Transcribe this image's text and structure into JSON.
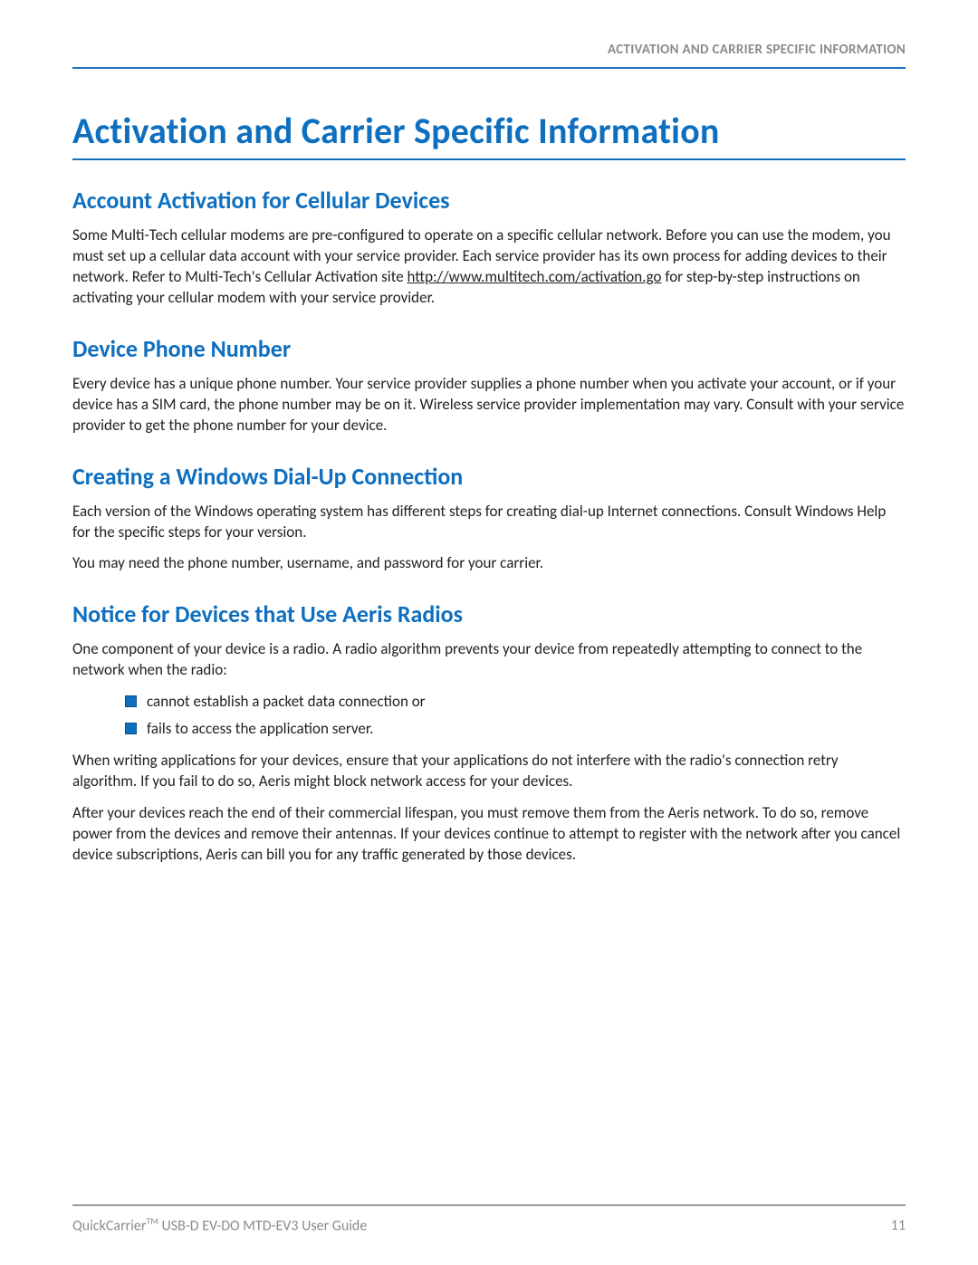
{
  "header": {
    "running_title": "ACTIVATION AND CARRIER SPECIFIC INFORMATION"
  },
  "h1": "Activation and Carrier Specific Information",
  "sections": {
    "acct": {
      "title": "Account Activation for Cellular Devices",
      "p1a": "Some Multi-Tech cellular modems are pre-configured to operate on a specific cellular network. Before you can use the modem, you must set up a cellular data account with your service provider. Each service provider has its own process for adding devices to their network. Refer to Multi-Tech's Cellular Activation site ",
      "link_text": "http://www.multitech.com/activation.go",
      "p1b": " for step-by-step instructions on activating your cellular modem with your service provider."
    },
    "phone": {
      "title": "Device Phone Number",
      "p1": "Every device has a unique phone number. Your service provider supplies a phone number when you activate your account, or if your device has a SIM card, the phone number may be on it. Wireless service provider implementation may vary. Consult with your service provider to get the phone number for your device."
    },
    "dialup": {
      "title": "Creating a Windows Dial-Up Connection",
      "p1": "Each version of the Windows operating system has different steps for creating dial-up Internet connections. Consult Windows Help for the specific steps for your version.",
      "p2": "You may need the phone number, username, and password for your carrier."
    },
    "aeris": {
      "title": "Notice for Devices that Use Aeris Radios",
      "p1": "One component of your device is a radio. A radio algorithm prevents your device from repeatedly attempting to connect to the network when the radio:",
      "bullets": [
        "cannot establish a packet data connection or",
        "fails to access the application server."
      ],
      "p2": "When writing applications for your devices, ensure that your applications do not interfere with the radio's connection retry algorithm. If you fail to do so, Aeris might block network access for your devices.",
      "p3": "After your devices reach the end of their commercial lifespan, you must remove them from the Aeris network. To do so, remove power from the devices and remove their antennas. If your devices continue to attempt to register with the network after you cancel device subscriptions, Aeris can bill you for any traffic generated by those devices."
    }
  },
  "footer": {
    "product": "QuickCarrier",
    "tm": "TM",
    "rest": " USB-D EV-DO MTD-EV3 User Guide",
    "page": "11"
  }
}
